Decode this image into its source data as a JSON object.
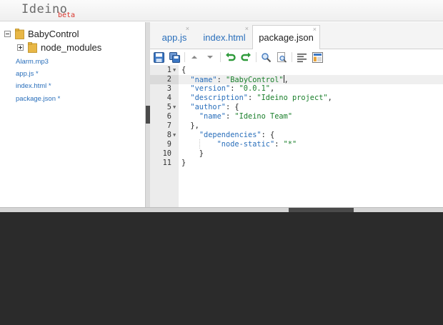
{
  "header": {
    "brand": "Ideino",
    "badge": "beta"
  },
  "sidebar": {
    "root": "BabyControl",
    "folder": "node_modules",
    "files": [
      "Alarm.mp3",
      "app.js *",
      "index.html *",
      "package.json *"
    ]
  },
  "tabs": [
    {
      "label": "app.js",
      "close": "×",
      "active": false
    },
    {
      "label": "index.html",
      "close": "×",
      "active": false
    },
    {
      "label": "package.json",
      "close": "×",
      "active": true
    }
  ],
  "toolbar": {
    "buttons": [
      "save-icon",
      "save-all-icon",
      "arrow-up-icon",
      "arrow-down-icon",
      "undo-icon",
      "redo-icon",
      "search-icon",
      "find-file-icon",
      "format-icon",
      "preview-icon"
    ]
  },
  "editor": {
    "active_line": 2,
    "lines": [
      {
        "n": "1",
        "fold": true,
        "text": "{"
      },
      {
        "n": "2",
        "fold": false,
        "text": "  \"name\": \"BabyControl\","
      },
      {
        "n": "3",
        "fold": false,
        "text": "  \"version\": \"0.0.1\","
      },
      {
        "n": "4",
        "fold": false,
        "text": "  \"description\": \"Ideino project\","
      },
      {
        "n": "5",
        "fold": true,
        "text": "  \"author\": {"
      },
      {
        "n": "6",
        "fold": false,
        "text": "    \"name\": \"Ideino Team\""
      },
      {
        "n": "7",
        "fold": false,
        "text": "  },"
      },
      {
        "n": "8",
        "fold": true,
        "text": "    \"dependencies\": {"
      },
      {
        "n": "9",
        "fold": false,
        "text": "        \"node-static\": \"*\""
      },
      {
        "n": "10",
        "fold": false,
        "text": "    }"
      },
      {
        "n": "11",
        "fold": false,
        "text": "}"
      }
    ]
  },
  "colors": {
    "accent": "#2a6fbb",
    "string": "#1a7f2b",
    "badge": "#d9342b",
    "console": "#2b2b2b"
  }
}
